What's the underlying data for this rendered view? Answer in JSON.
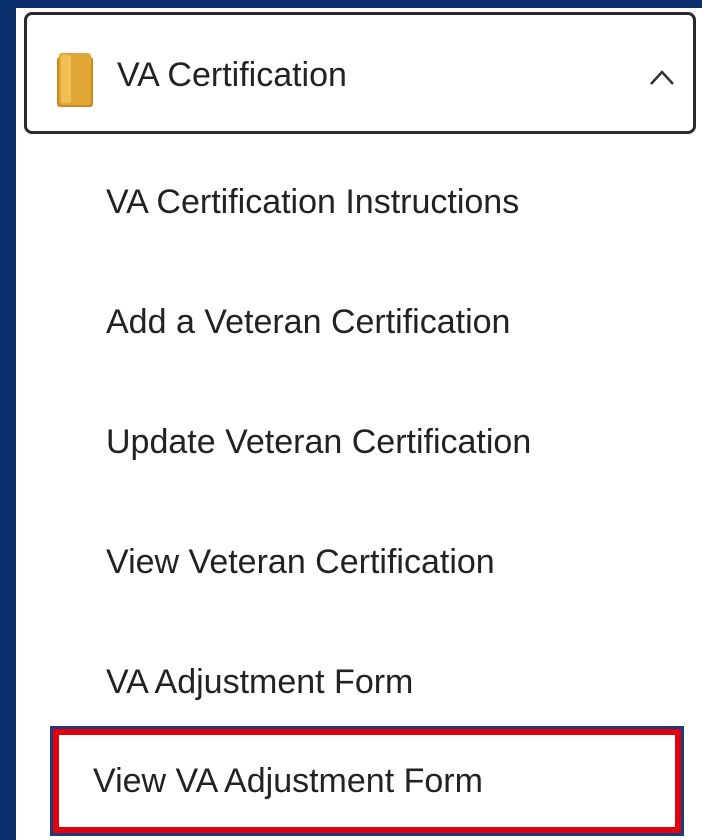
{
  "menu": {
    "header_label": "VA Certification",
    "items": [
      {
        "label": "VA Certification Instructions"
      },
      {
        "label": "Add a Veteran Certification"
      },
      {
        "label": "Update Veteran Certification"
      },
      {
        "label": "View Veteran Certification"
      },
      {
        "label": "VA Adjustment Form"
      },
      {
        "label": "View VA Adjustment Form",
        "highlighted": true
      }
    ]
  },
  "colors": {
    "background": "#0b2f6b",
    "panel": "#ffffff",
    "text": "#222222",
    "folder": "#e0a735",
    "highlight_outline": "#e3000f"
  },
  "icons": {
    "header_icon": "folder-icon",
    "expand_icon": "chevron-up-icon"
  }
}
